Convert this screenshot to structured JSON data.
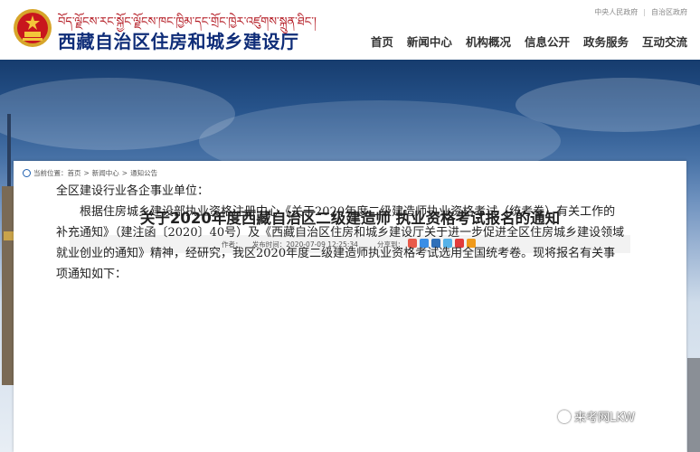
{
  "header": {
    "tibetan_text": "བོད་ལྗོངས་རང་སྐྱོང་ལྗོངས་ཁང་ཁྱིམ་དང་གྲོང་ཁྱེར་འཛུགས་སྐྲུན་ཐིང་།",
    "site_title": "西藏自治区住房和城乡建设厅",
    "top_links": [
      "中央人民政府",
      "自治区政府"
    ],
    "nav": [
      "首页",
      "新闻中心",
      "机构概况",
      "信息公开",
      "政务服务",
      "互动交流"
    ]
  },
  "breadcrumb": {
    "prefix": "当前位置：",
    "items": [
      "首页",
      "新闻中心",
      "通知公告"
    ],
    "separator": ">"
  },
  "article": {
    "title": "关于2020年度西藏自治区二级建造师 执业资格考试报名的通知",
    "meta": "作者：　　发布时间：2020-07-09 12:25:34",
    "share_label": "分享到：",
    "share_icon_colors": [
      "#e85a4a",
      "#3a8ee6",
      "#2f6fb8",
      "#56b2e8",
      "#e23b3b",
      "#f09a1a"
    ],
    "salutation": "全区建设行业各企事业单位：",
    "paragraph": "根据住房城乡建设部执业资格注册中心《关于2020年度二级建造师执业资格考试（统考卷）有关工作的补充通知》（建注函〔2020〕40号）及《西藏自治区住房和城乡建设厅关于进一步促进全区住房城乡建设领域就业创业的通知》精神，经研究，我区2020年度二级建造师执业资格考试选用全国统考卷。现将报名有关事项通知如下："
  },
  "watermark": "来考网LKW",
  "colors": {
    "brand_red": "#b1121b",
    "brand_blue": "#0f2d78"
  }
}
